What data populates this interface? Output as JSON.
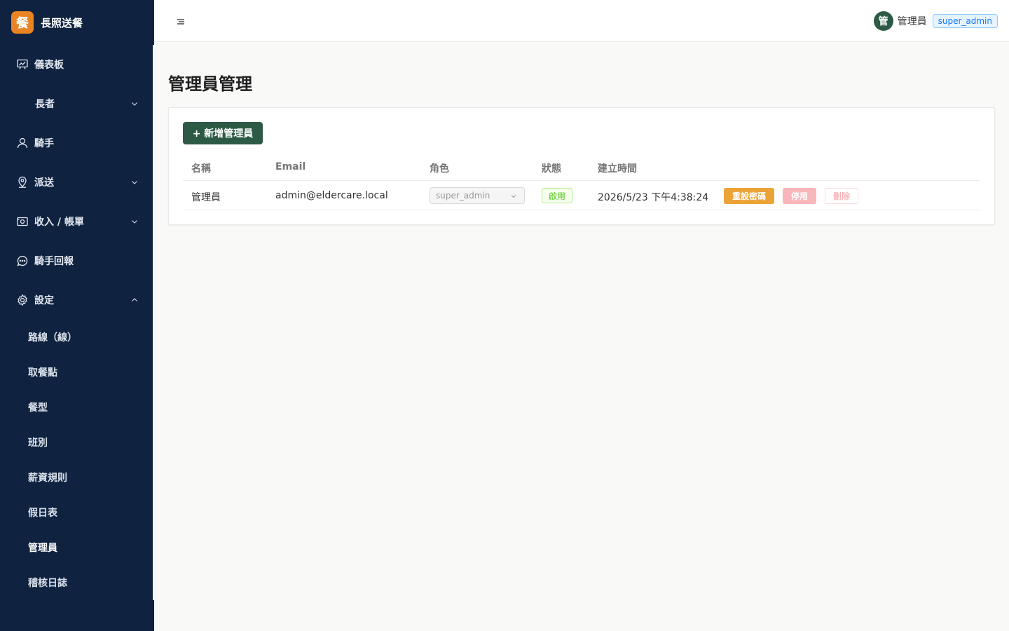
{
  "brand": {
    "logo_char": "餐",
    "name": "長照送餐"
  },
  "sidebar": {
    "items": [
      {
        "label": "儀表板",
        "icon": "dashboard-icon"
      },
      {
        "label": "長者",
        "icon": "none",
        "expandable": true
      },
      {
        "label": "騎手",
        "icon": "user-icon"
      },
      {
        "label": "派送",
        "icon": "location-icon",
        "expandable": true
      },
      {
        "label": "收入 / 帳單",
        "icon": "wallet-icon",
        "expandable": true
      },
      {
        "label": "騎手回報",
        "icon": "message-icon"
      },
      {
        "label": "設定",
        "icon": "gear-icon",
        "expandable": true,
        "expanded": true
      }
    ],
    "settings_children": [
      "路線（線）",
      "取餐點",
      "餐型",
      "班別",
      "薪資規則",
      "假日表",
      "管理員",
      "稽核日誌"
    ],
    "active_child": "管理員"
  },
  "header": {
    "avatar_char": "管",
    "user_name": "管理員",
    "role_badge": "super_admin"
  },
  "page": {
    "title": "管理員管理",
    "add_button": "+ 新增管理員"
  },
  "table": {
    "columns": [
      "名稱",
      "Email",
      "角色",
      "狀態",
      "建立時間"
    ],
    "rows": [
      {
        "name": "管理員",
        "email": "admin@eldercare.local",
        "role": "super_admin",
        "status": "啟用",
        "created": "2026/5/23 下午4:38:24",
        "actions": {
          "reset": "重設密碼",
          "disable": "停用",
          "delete": "刪除"
        }
      }
    ]
  },
  "colors": {
    "sidebar_bg": "#0f2341",
    "brand_logo": "#ea8423",
    "primary": "#2d5a45",
    "warning": "#eba337",
    "danger_light": "#f8b6bb",
    "success": "#52c41a",
    "info": "#1677ff"
  }
}
